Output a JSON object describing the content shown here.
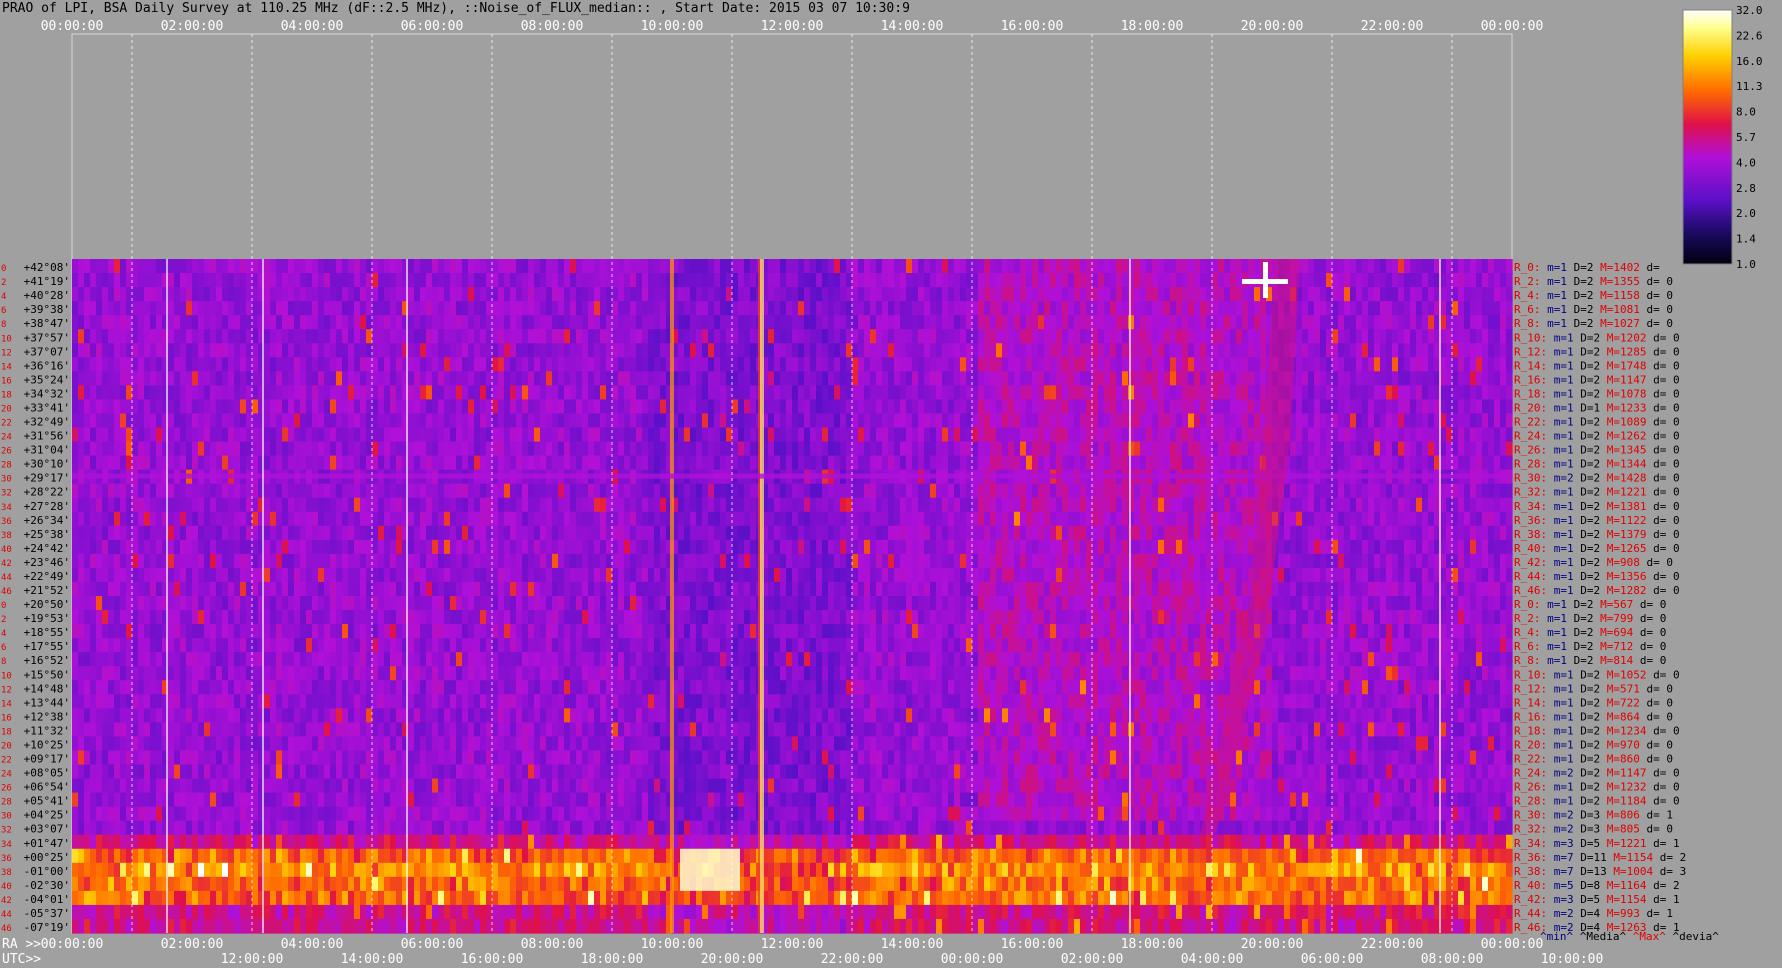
{
  "title": "PRAO of LPI, BSA Daily Survey at 110.25 MHz (dF::2.5 MHz), ::Noise_of_FLUX_median:: , Start Date: 2015 03 07 10:30:9",
  "chart_data": {
    "type": "heatmap",
    "top_axis_ticks": [
      "00:00:00",
      "02:00:00",
      "04:00:00",
      "06:00:00",
      "08:00:00",
      "10:00:00",
      "12:00:00",
      "14:00:00",
      "16:00:00",
      "18:00:00",
      "20:00:00",
      "22:00:00",
      "00:00:00"
    ],
    "ra_label": "RA >>",
    "ra_ticks": [
      "00:00:00",
      "02:00:00",
      "04:00:00",
      "06:00:00",
      "08:00:00",
      "10:00:00",
      "12:00:00",
      "14:00:00",
      "16:00:00",
      "18:00:00",
      "20:00:00",
      "22:00:00",
      "00:00:00"
    ],
    "utc_label": "UTC>>",
    "utc_ticks": [
      "12:00:00",
      "14:00:00",
      "16:00:00",
      "18:00:00",
      "20:00:00",
      "22:00:00",
      "00:00:00",
      "02:00:00",
      "04:00:00",
      "06:00:00",
      "08:00:00",
      "10:00:00"
    ],
    "row_index_labels": [
      "0",
      "2",
      "4",
      "6",
      "8",
      "10",
      "12",
      "14",
      "16",
      "18",
      "20",
      "22",
      "24",
      "26",
      "28",
      "30",
      "32",
      "34",
      "36",
      "38",
      "40",
      "42",
      "44",
      "46",
      "0",
      "2",
      "4",
      "6",
      "8",
      "10",
      "12",
      "14",
      "16",
      "18",
      "20",
      "22",
      "24",
      "26",
      "28",
      "30",
      "32",
      "34",
      "36",
      "38",
      "40",
      "42",
      "44",
      "46"
    ],
    "declinations": [
      "+42°08'",
      "+41°19'",
      "+40°28'",
      "+39°38'",
      "+38°47'",
      "+37°57'",
      "+37°07'",
      "+36°16'",
      "+35°24'",
      "+34°32'",
      "+33°41'",
      "+32°49'",
      "+31°56'",
      "+31°04'",
      "+30°10'",
      "+29°17'",
      "+28°22'",
      "+27°28'",
      "+26°34'",
      "+25°38'",
      "+24°42'",
      "+23°46'",
      "+22°49'",
      "+21°52'",
      "+20°50'",
      "+19°53'",
      "+18°55'",
      "+17°55'",
      "+16°52'",
      "+15°50'",
      "+14°48'",
      "+13°44'",
      "+12°38'",
      "+11°32'",
      "+10°25'",
      "+09°17'",
      "+08°05'",
      "+06°54'",
      "+05°41'",
      "+04°25'",
      "+03°07'",
      "+01°47'",
      "+00°25'",
      "-01°00'",
      "-02°30'",
      "-04°01'",
      "-05°37'",
      "-07°19'"
    ],
    "beam_stats": [
      {
        "r": "R_0:",
        "m": "m=1",
        "d": "D=2",
        "M": "M=1402",
        "dv": "d="
      },
      {
        "r": "R_2:",
        "m": "m=1",
        "d": "D=2",
        "M": "M=1355",
        "dv": "d= 0"
      },
      {
        "r": "R_4:",
        "m": "m=1",
        "d": "D=2",
        "M": "M=1158",
        "dv": "d= 0"
      },
      {
        "r": "R_6:",
        "m": "m=1",
        "d": "D=2",
        "M": "M=1081",
        "dv": "d= 0"
      },
      {
        "r": "R_8:",
        "m": "m=1",
        "d": "D=2",
        "M": "M=1027",
        "dv": "d= 0"
      },
      {
        "r": "R_10:",
        "m": "m=1",
        "d": "D=2",
        "M": "M=1202",
        "dv": "d= 0"
      },
      {
        "r": "R_12:",
        "m": "m=1",
        "d": "D=2",
        "M": "M=1285",
        "dv": "d= 0"
      },
      {
        "r": "R_14:",
        "m": "m=1",
        "d": "D=2",
        "M": "M=1748",
        "dv": "d= 0"
      },
      {
        "r": "R_16:",
        "m": "m=1",
        "d": "D=2",
        "M": "M=1147",
        "dv": "d= 0"
      },
      {
        "r": "R_18:",
        "m": "m=1",
        "d": "D=2",
        "M": "M=1078",
        "dv": "d= 0"
      },
      {
        "r": "R_20:",
        "m": "m=1",
        "d": "D=1",
        "M": "M=1233",
        "dv": "d= 0"
      },
      {
        "r": "R_22:",
        "m": "m=1",
        "d": "D=2",
        "M": "M=1089",
        "dv": "d= 0"
      },
      {
        "r": "R_24:",
        "m": "m=1",
        "d": "D=2",
        "M": "M=1262",
        "dv": "d= 0"
      },
      {
        "r": "R_26:",
        "m": "m=1",
        "d": "D=2",
        "M": "M=1345",
        "dv": "d= 0"
      },
      {
        "r": "R_28:",
        "m": "m=1",
        "d": "D=2",
        "M": "M=1344",
        "dv": "d= 0"
      },
      {
        "r": "R_30:",
        "m": "m=2",
        "d": "D=2",
        "M": "M=1428",
        "dv": "d= 0"
      },
      {
        "r": "R_32:",
        "m": "m=1",
        "d": "D=2",
        "M": "M=1221",
        "dv": "d= 0"
      },
      {
        "r": "R_34:",
        "m": "m=1",
        "d": "D=2",
        "M": "M=1381",
        "dv": "d= 0"
      },
      {
        "r": "R_36:",
        "m": "m=1",
        "d": "D=2",
        "M": "M=1122",
        "dv": "d= 0"
      },
      {
        "r": "R_38:",
        "m": "m=1",
        "d": "D=2",
        "M": "M=1379",
        "dv": "d= 0"
      },
      {
        "r": "R_40:",
        "m": "m=1",
        "d": "D=2",
        "M": "M=1265",
        "dv": "d= 0"
      },
      {
        "r": "R_42:",
        "m": "m=1",
        "d": "D=2",
        "M": "M=908",
        "dv": "d= 0"
      },
      {
        "r": "R_44:",
        "m": "m=1",
        "d": "D=2",
        "M": "M=1356",
        "dv": "d= 0"
      },
      {
        "r": "R_46:",
        "m": "m=1",
        "d": "D=2",
        "M": "M=1282",
        "dv": "d= 0"
      },
      {
        "r": "R_0:",
        "m": "m=1",
        "d": "D=2",
        "M": "M=567",
        "dv": "d= 0"
      },
      {
        "r": "R_2:",
        "m": "m=1",
        "d": "D=2",
        "M": "M=799",
        "dv": "d= 0"
      },
      {
        "r": "R_4:",
        "m": "m=1",
        "d": "D=2",
        "M": "M=694",
        "dv": "d= 0"
      },
      {
        "r": "R_6:",
        "m": "m=1",
        "d": "D=2",
        "M": "M=712",
        "dv": "d= 0"
      },
      {
        "r": "R_8:",
        "m": "m=1",
        "d": "D=2",
        "M": "M=814",
        "dv": "d= 0"
      },
      {
        "r": "R_10:",
        "m": "m=1",
        "d": "D=2",
        "M": "M=1052",
        "dv": "d= 0"
      },
      {
        "r": "R_12:",
        "m": "m=1",
        "d": "D=2",
        "M": "M=571",
        "dv": "d= 0"
      },
      {
        "r": "R_14:",
        "m": "m=1",
        "d": "D=2",
        "M": "M=722",
        "dv": "d= 0"
      },
      {
        "r": "R_16:",
        "m": "m=1",
        "d": "D=2",
        "M": "M=864",
        "dv": "d= 0"
      },
      {
        "r": "R_18:",
        "m": "m=1",
        "d": "D=2",
        "M": "M=1234",
        "dv": "d= 0"
      },
      {
        "r": "R_20:",
        "m": "m=1",
        "d": "D=2",
        "M": "M=970",
        "dv": "d= 0"
      },
      {
        "r": "R_22:",
        "m": "m=1",
        "d": "D=2",
        "M": "M=860",
        "dv": "d= 0"
      },
      {
        "r": "R_24:",
        "m": "m=2",
        "d": "D=2",
        "M": "M=1147",
        "dv": "d= 0"
      },
      {
        "r": "R_26:",
        "m": "m=1",
        "d": "D=2",
        "M": "M=1232",
        "dv": "d= 0"
      },
      {
        "r": "R_28:",
        "m": "m=1",
        "d": "D=2",
        "M": "M=1184",
        "dv": "d= 0"
      },
      {
        "r": "R_30:",
        "m": "m=2",
        "d": "D=3",
        "M": "M=806",
        "dv": "d= 1"
      },
      {
        "r": "R_32:",
        "m": "m=2",
        "d": "D=3",
        "M": "M=805",
        "dv": "d= 0"
      },
      {
        "r": "R_34:",
        "m": "m=3",
        "d": "D=5",
        "M": "M=1221",
        "dv": "d= 1"
      },
      {
        "r": "R_36:",
        "m": "m=7",
        "d": "D=11",
        "M": "M=1154",
        "dv": "d= 2"
      },
      {
        "r": "R_38:",
        "m": "m=7",
        "d": "D=13",
        "M": "M=1004",
        "dv": "d= 3"
      },
      {
        "r": "R_40:",
        "m": "m=5",
        "d": "D=8",
        "M": "M=1164",
        "dv": "d= 2"
      },
      {
        "r": "R_42:",
        "m": "m=3",
        "d": "D=5",
        "M": "M=1154",
        "dv": "d= 1"
      },
      {
        "r": "R_44:",
        "m": "m=2",
        "d": "D=4",
        "M": "M=993",
        "dv": "d= 1"
      },
      {
        "r": "R_46:",
        "m": "m=2",
        "d": "D=4",
        "M": "M=1263",
        "dv": "d= 1"
      }
    ],
    "footer_legend": {
      "min": "^min^",
      "media": "^Media^",
      "max": "^Max^",
      "devia": "^devia^"
    },
    "colorbar_ticks": [
      "32.0",
      "22.6",
      "16.0",
      "11.3",
      "8.0",
      "5.7",
      "4.0",
      "2.8",
      "2.0",
      "1.4",
      "1.0"
    ],
    "colors": {
      "background": "#a0a0a0",
      "label_red": "#e00000",
      "label_blue": "#000080",
      "label_dark": "#000000",
      "tick_white": "#ffffff"
    }
  }
}
